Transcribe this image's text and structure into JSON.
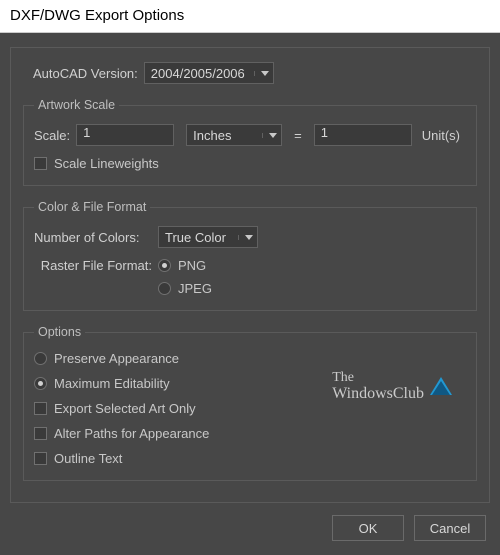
{
  "title": "DXF/DWG Export Options",
  "version": {
    "label": "AutoCAD Version:",
    "value": "2004/2005/2006"
  },
  "artwork_scale": {
    "legend": "Artwork Scale",
    "scale_label": "Scale:",
    "scale_value": "1",
    "unit_select": "Inches",
    "equals": "=",
    "result_value": "1",
    "units_label": "Unit(s)",
    "scale_lineweights": "Scale Lineweights"
  },
  "color_format": {
    "legend": "Color & File Format",
    "num_colors_label": "Number of Colors:",
    "num_colors_value": "True Color",
    "raster_label": "Raster File Format:",
    "png": "PNG",
    "jpeg": "JPEG"
  },
  "options": {
    "legend": "Options",
    "preserve": "Preserve Appearance",
    "max_edit": "Maximum Editability",
    "export_selected": "Export Selected Art Only",
    "alter_paths": "Alter Paths for Appearance",
    "outline_text": "Outline Text"
  },
  "footer": {
    "ok": "OK",
    "cancel": "Cancel"
  },
  "watermark": {
    "l1": "The",
    "l2": "WindowsClub"
  }
}
